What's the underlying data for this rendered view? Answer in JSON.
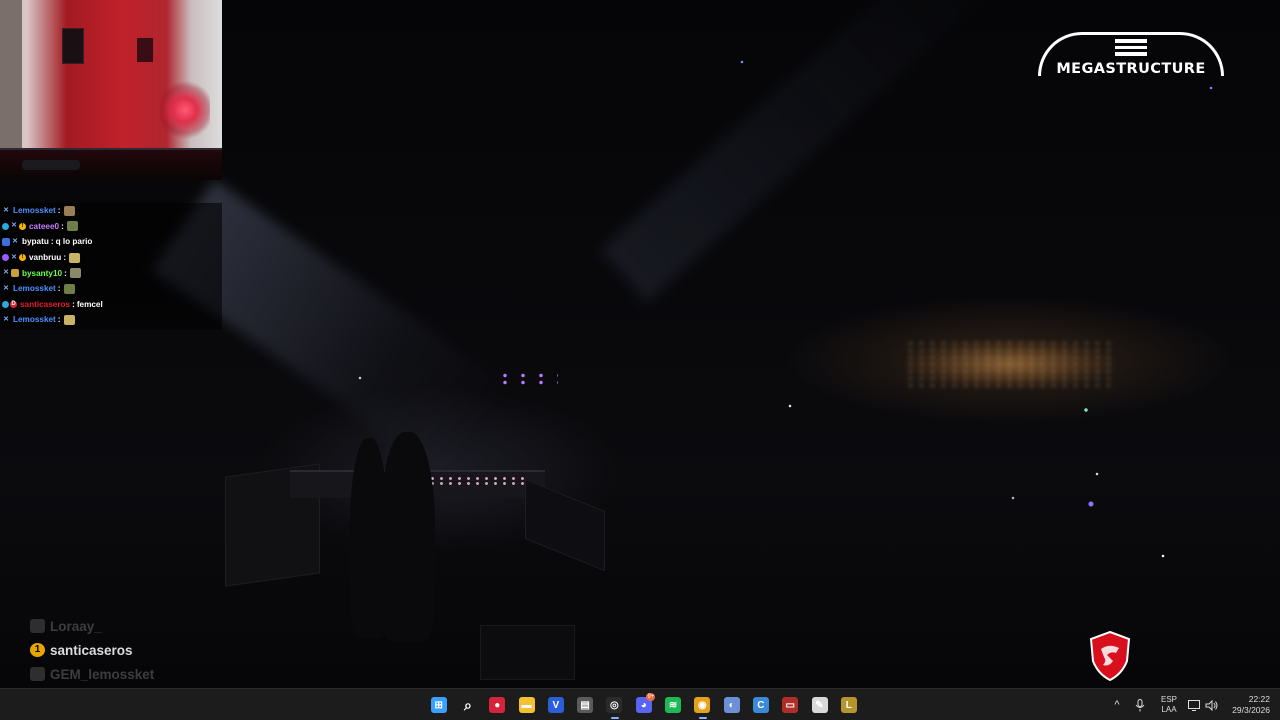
{
  "overlay": {
    "brand_logo": "MEGASTRUCTURE",
    "sponsor_logo": "msi-dragon-shield"
  },
  "chat": {
    "messages": [
      {
        "user": "Lemossket",
        "color": "#4f8fff",
        "badges": [
          "sword"
        ],
        "text": "",
        "emote": "#9a7c55"
      },
      {
        "user": "cateee0",
        "color": "#c37fff",
        "badges": [
          "gem",
          "sword",
          "coin"
        ],
        "text": "",
        "emote": "#6f7d4a"
      },
      {
        "user": "bypatu",
        "color": "#ffffff",
        "badges": [
          "box",
          "sword"
        ],
        "text": "q lo pario",
        "emote": ""
      },
      {
        "user": "vanbruu",
        "color": "#ffffff",
        "badges": [
          "gem-purple",
          "sword",
          "coin"
        ],
        "text": "",
        "emote": "#c8b464"
      },
      {
        "user": "bysanty10",
        "color": "#6cff4a",
        "badges": [
          "sword",
          "crown"
        ],
        "text": "",
        "emote": "#8a8a6a"
      },
      {
        "user": "Lemossket",
        "color": "#4f8fff",
        "badges": [
          "sword"
        ],
        "text": "",
        "emote": "#6f7d4a"
      },
      {
        "user": "santicaseros",
        "color": "#e8192c",
        "badges": [
          "gem",
          "red"
        ],
        "text": "femcel",
        "emote": ""
      },
      {
        "user": "Lemossket",
        "color": "#4f8fff",
        "badges": [
          "sword"
        ],
        "text": "",
        "emote": "#c8b464"
      }
    ]
  },
  "alerts": [
    {
      "name": "Loraay_",
      "state": "dim"
    },
    {
      "name": "santicaseros",
      "state": "lit"
    },
    {
      "name": "GEM_lemossket",
      "state": "dim"
    }
  ],
  "taskbar": {
    "apps": [
      {
        "name": "windows-start-icon",
        "color": "#3aa0ff",
        "glyph": "⊞",
        "active": false
      },
      {
        "name": "search-icon",
        "color": "transparent",
        "glyph": "⌕",
        "active": false
      },
      {
        "name": "red-app-icon",
        "color": "#d8243a",
        "glyph": "●",
        "active": false
      },
      {
        "name": "file-explorer-icon",
        "color": "#f2c232",
        "glyph": "▬",
        "active": false
      },
      {
        "name": "v-app-icon",
        "color": "#2b5fd9",
        "glyph": "V",
        "active": false
      },
      {
        "name": "store-icon",
        "color": "#5a5a5a",
        "glyph": "▤",
        "active": false
      },
      {
        "name": "obs-icon",
        "color": "#2b2b2b",
        "glyph": "◎",
        "active": true
      },
      {
        "name": "discord-icon",
        "color": "#5865f2",
        "glyph": "◕",
        "active": false,
        "badge": "9+"
      },
      {
        "name": "spotify-icon",
        "color": "#1db954",
        "glyph": "≋",
        "active": false
      },
      {
        "name": "chrome-icon",
        "color": "#e3a21a",
        "glyph": "◉",
        "active": true
      },
      {
        "name": "shell-app-icon",
        "color": "#6c8fd8",
        "glyph": "◐",
        "active": false
      },
      {
        "name": "c-app-icon",
        "color": "#3a8ad8",
        "glyph": "C",
        "active": false
      },
      {
        "name": "voicemeeter-icon",
        "color": "#b02e26",
        "glyph": "▭",
        "active": false
      },
      {
        "name": "notepad-icon",
        "color": "#d9d9d9",
        "glyph": "✎",
        "active": false
      },
      {
        "name": "league-icon",
        "color": "#b5952c",
        "glyph": "L",
        "active": false
      }
    ],
    "tray": {
      "chevron": "^",
      "mic": "mic-icon",
      "lang_line1": "ESP",
      "lang_line2": "LAA",
      "time": "22:22",
      "date": "29/3/2026"
    }
  }
}
